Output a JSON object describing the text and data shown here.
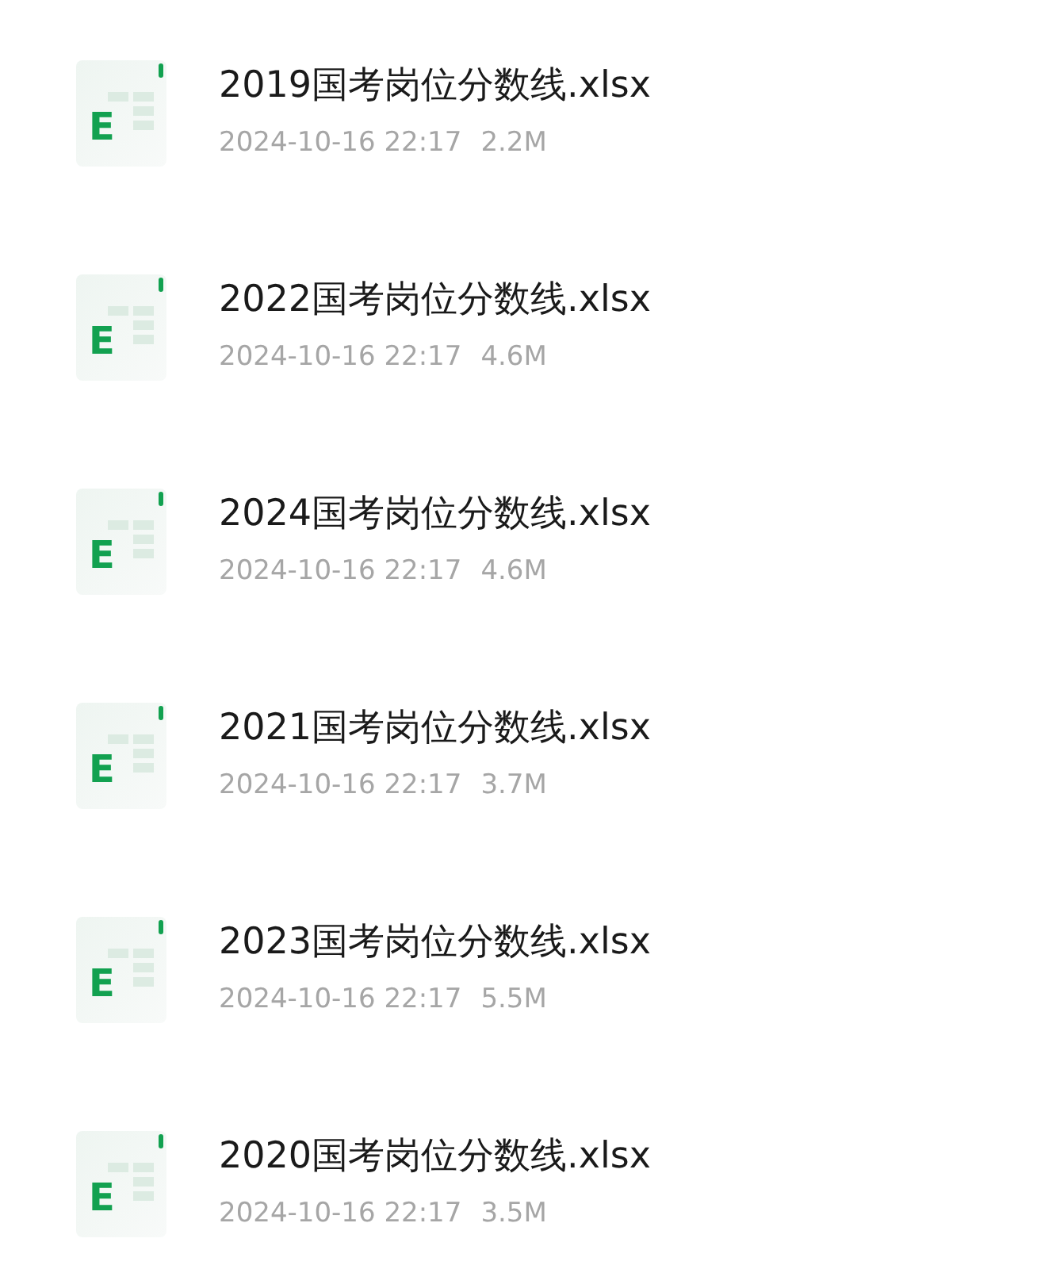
{
  "files": [
    {
      "icon_label": "E",
      "name": "2019国考岗位分数线.xlsx",
      "date": "2024-10-16 22:17",
      "size": "2.2M"
    },
    {
      "icon_label": "E",
      "name": "2022国考岗位分数线.xlsx",
      "date": "2024-10-16 22:17",
      "size": "4.6M"
    },
    {
      "icon_label": "E",
      "name": "2024国考岗位分数线.xlsx",
      "date": "2024-10-16 22:17",
      "size": "4.6M"
    },
    {
      "icon_label": "E",
      "name": "2021国考岗位分数线.xlsx",
      "date": "2024-10-16 22:17",
      "size": "3.7M"
    },
    {
      "icon_label": "E",
      "name": "2023国考岗位分数线.xlsx",
      "date": "2024-10-16 22:17",
      "size": "5.5M"
    },
    {
      "icon_label": "E",
      "name": "2020国考岗位分数线.xlsx",
      "date": "2024-10-16 22:17",
      "size": "3.5M"
    }
  ]
}
